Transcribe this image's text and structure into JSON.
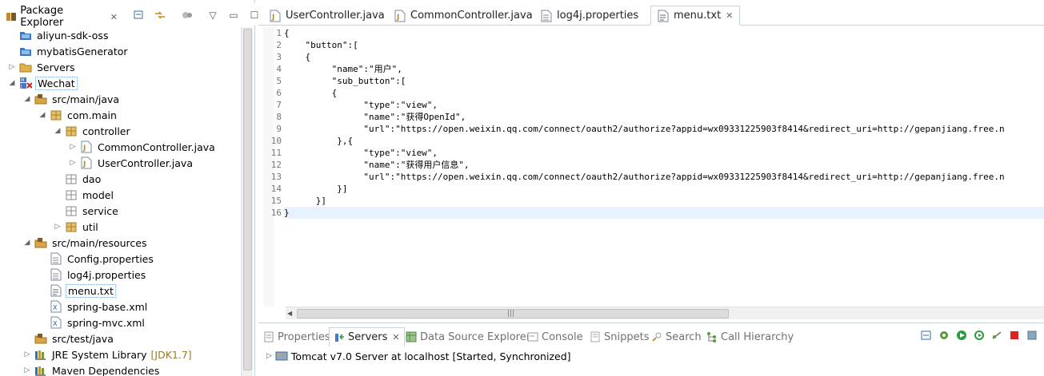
{
  "package_explorer": {
    "tab_label": "Package Explorer",
    "tree": [
      {
        "label": "aliyun-sdk-oss",
        "icon": "project-folder-icon",
        "depth": 0,
        "twisty": ""
      },
      {
        "label": "mybatisGenerator",
        "icon": "project-folder-icon",
        "depth": 0,
        "twisty": ""
      },
      {
        "label": "Servers",
        "icon": "folder-icon",
        "depth": 0,
        "twisty": "▷"
      },
      {
        "label": "Wechat",
        "icon": "web-project-icon",
        "depth": 0,
        "twisty": "◢",
        "selected": true
      },
      {
        "label": "src/main/java",
        "icon": "source-folder-icon",
        "depth": 1,
        "twisty": "◢"
      },
      {
        "label": "com.main",
        "icon": "package-icon",
        "depth": 2,
        "twisty": "◢"
      },
      {
        "label": "controller",
        "icon": "package-icon",
        "depth": 3,
        "twisty": "◢"
      },
      {
        "label": "CommonController.java",
        "icon": "java-file-icon",
        "depth": 4,
        "twisty": "▷"
      },
      {
        "label": "UserController.java",
        "icon": "java-file-icon",
        "depth": 4,
        "twisty": "▷"
      },
      {
        "label": "dao",
        "icon": "empty-package-icon",
        "depth": 3,
        "twisty": ""
      },
      {
        "label": "model",
        "icon": "empty-package-icon",
        "depth": 3,
        "twisty": ""
      },
      {
        "label": "service",
        "icon": "empty-package-icon",
        "depth": 3,
        "twisty": ""
      },
      {
        "label": "util",
        "icon": "package-icon",
        "depth": 3,
        "twisty": "▷"
      },
      {
        "label": "src/main/resources",
        "icon": "source-folder-icon",
        "depth": 1,
        "twisty": "◢"
      },
      {
        "label": "Config.properties",
        "icon": "properties-file-icon",
        "depth": 2,
        "twisty": ""
      },
      {
        "label": "log4j.properties",
        "icon": "properties-file-icon",
        "depth": 2,
        "twisty": ""
      },
      {
        "label": "menu.txt",
        "icon": "text-file-icon",
        "depth": 2,
        "twisty": "",
        "boxed": true
      },
      {
        "label": "spring-base.xml",
        "icon": "xml-file-icon",
        "depth": 2,
        "twisty": ""
      },
      {
        "label": "spring-mvc.xml",
        "icon": "xml-file-icon",
        "depth": 2,
        "twisty": ""
      },
      {
        "label": "src/test/java",
        "icon": "source-folder-icon",
        "depth": 1,
        "twisty": ""
      },
      {
        "label": "JRE System Library",
        "icon": "library-icon",
        "depth": 1,
        "twisty": "▷",
        "decoration": "[JDK1.7]"
      },
      {
        "label": "Maven Dependencies",
        "icon": "library-icon",
        "depth": 1,
        "twisty": "▷"
      }
    ]
  },
  "editor": {
    "tabs": [
      {
        "label": "UserController.java",
        "icon": "java-file-icon",
        "active": false
      },
      {
        "label": "CommonController.java",
        "icon": "java-file-icon",
        "active": false
      },
      {
        "label": "log4j.properties",
        "icon": "properties-file-icon",
        "active": false
      },
      {
        "label": "menu.txt",
        "icon": "text-file-icon",
        "active": true
      }
    ],
    "lines": [
      "{",
      "    \"button\":[",
      "    {",
      "         \"name\":\"用户\",",
      "         \"sub_button\":[",
      "         {",
      "               \"type\":\"view\",",
      "               \"name\":\"获得OpenId\",",
      "               \"url\":\"https://open.weixin.qq.com/connect/oauth2/authorize?appid=wx09331225903f8414&redirect_uri=http://gepanjiang.free.n",
      "          },{",
      "               \"type\":\"view\",",
      "               \"name\":\"获得用户信息\",",
      "               \"url\":\"https://open.weixin.qq.com/connect/oauth2/authorize?appid=wx09331225903f8414&redirect_uri=http://gepanjiang.free.n",
      "          }]",
      "      }]",
      "}"
    ],
    "current_line": 16
  },
  "bottom": {
    "tabs": [
      {
        "label": "Properties",
        "icon": "properties-view-icon",
        "active": false
      },
      {
        "label": "Servers",
        "icon": "servers-view-icon",
        "active": true
      },
      {
        "label": "Data Source Explorer",
        "icon": "data-source-icon",
        "active": false
      },
      {
        "label": "Console",
        "icon": "console-icon",
        "active": false
      },
      {
        "label": "Snippets",
        "icon": "snippets-icon",
        "active": false
      },
      {
        "label": "Search",
        "icon": "search-icon",
        "active": false
      },
      {
        "label": "Call Hierarchy",
        "icon": "call-hierarchy-icon",
        "active": false
      }
    ],
    "server_row": "Tomcat v7.0 Server at localhost  [Started, Synchronized]"
  },
  "colors": {
    "accent": "#3a6ea5",
    "current_line": "#e8f2fe",
    "decoration": "#9a7a2a"
  }
}
